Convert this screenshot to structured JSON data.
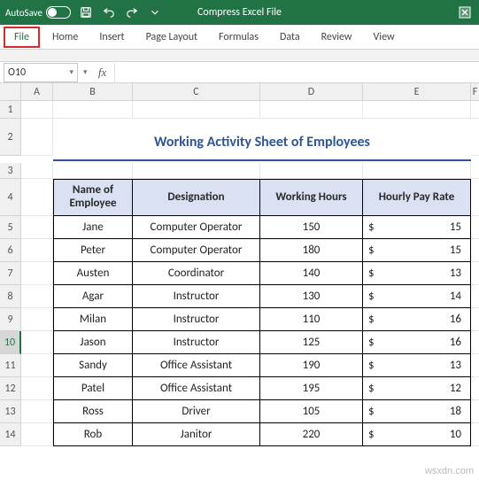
{
  "titlebar": {
    "autosave_label": "AutoSave",
    "doc_title": "Compress Excel File"
  },
  "tabs": {
    "file": "File",
    "home": "Home",
    "insert": "Insert",
    "page_layout": "Page Layout",
    "formulas": "Formulas",
    "data": "Data",
    "review": "Review",
    "view": "View"
  },
  "namebox": {
    "value": "O10"
  },
  "formula_bar": {
    "fx": "fx"
  },
  "columns": [
    "A",
    "B",
    "C",
    "D",
    "E",
    "F"
  ],
  "rows": [
    "1",
    "2",
    "3",
    "4",
    "5",
    "6",
    "7",
    "8",
    "9",
    "10",
    "11",
    "12",
    "13",
    "14"
  ],
  "sheet_title": "Working Activity Sheet of Employees",
  "headers": {
    "col_b": "Name of Employee",
    "col_c": "Designation",
    "col_d": "Working Hours",
    "col_e": "Hourly Pay Rate"
  },
  "currency": "$",
  "data_rows": [
    {
      "name": "Jane",
      "designation": "Computer Operator",
      "hours": "150",
      "rate": "15"
    },
    {
      "name": "Peter",
      "designation": "Computer Operator",
      "hours": "180",
      "rate": "15"
    },
    {
      "name": "Austen",
      "designation": "Coordinator",
      "hours": "140",
      "rate": "13"
    },
    {
      "name": "Agar",
      "designation": "Instructor",
      "hours": "130",
      "rate": "14"
    },
    {
      "name": "Milan",
      "designation": "Instructor",
      "hours": "110",
      "rate": "16"
    },
    {
      "name": "Jason",
      "designation": "Instructor",
      "hours": "125",
      "rate": "16"
    },
    {
      "name": "Sandy",
      "designation": "Office Assistant",
      "hours": "190",
      "rate": "13"
    },
    {
      "name": "Patel",
      "designation": "Office Assistant",
      "hours": "195",
      "rate": "12"
    },
    {
      "name": "Ross",
      "designation": "Driver",
      "hours": "105",
      "rate": "18"
    },
    {
      "name": "Rob",
      "designation": "Janitor",
      "hours": "220",
      "rate": "10"
    }
  ],
  "watermark": "wsxdn.com"
}
